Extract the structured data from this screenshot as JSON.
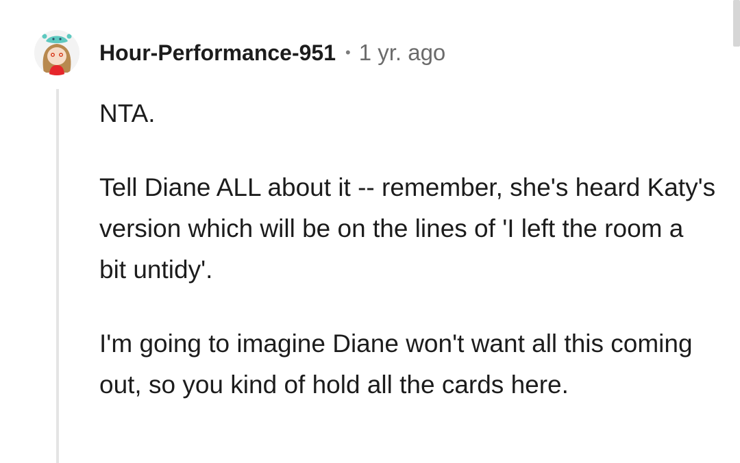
{
  "comment": {
    "author": "Hour-Performance-951",
    "separator": "•",
    "age": "1 yr. ago",
    "paragraphs": [
      "NTA.",
      "Tell Diane ALL about it -- remember, she's heard Katy's version which will be on the lines of 'I left the room a bit untidy'.",
      "I'm going to imagine Diane won't want all this coming out, so you kind of hold all the cards here."
    ]
  },
  "avatar": {
    "icon": "snoo-avatar-icon",
    "colors": {
      "hat": "#5ec9c0",
      "hair": "#b8894f",
      "face": "#f6dcc8",
      "shirt": "#e6262b"
    }
  }
}
